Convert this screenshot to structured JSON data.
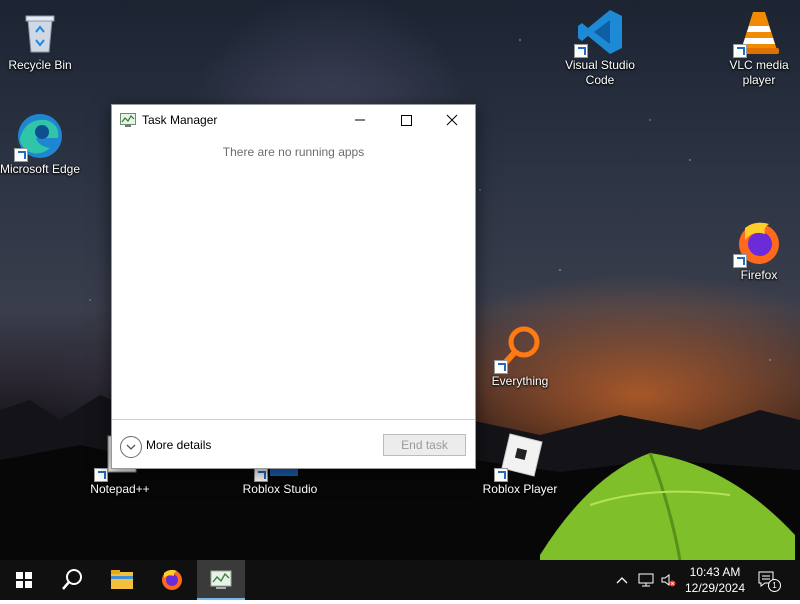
{
  "desktop_icons": [
    {
      "id": "recycle-bin",
      "label": "Recycle Bin"
    },
    {
      "id": "microsoft-edge",
      "label": "Microsoft Edge"
    },
    {
      "id": "vscode",
      "label": "Visual Studio Code"
    },
    {
      "id": "vlc",
      "label": "VLC media player"
    },
    {
      "id": "firefox",
      "label": "Firefox"
    },
    {
      "id": "everything",
      "label": "Everything"
    },
    {
      "id": "notepadpp",
      "label": "Notepad++"
    },
    {
      "id": "roblox-studio",
      "label": "Roblox Studio"
    },
    {
      "id": "roblox-player",
      "label": "Roblox Player"
    }
  ],
  "task_manager": {
    "title": "Task Manager",
    "empty_message": "There are no running apps",
    "more_details": "More details",
    "end_task": "End task"
  },
  "taskbar": {
    "icons": [
      "windows-start-icon",
      "search-icon",
      "file-explorer-icon",
      "firefox-icon",
      "task-manager-icon"
    ],
    "time": "10:43 AM",
    "date": "12/29/2024",
    "notification_count": "1"
  },
  "colors": {
    "taskbar": "#101010",
    "accent": "#76b9ed",
    "window_bg": "#ffffff"
  }
}
